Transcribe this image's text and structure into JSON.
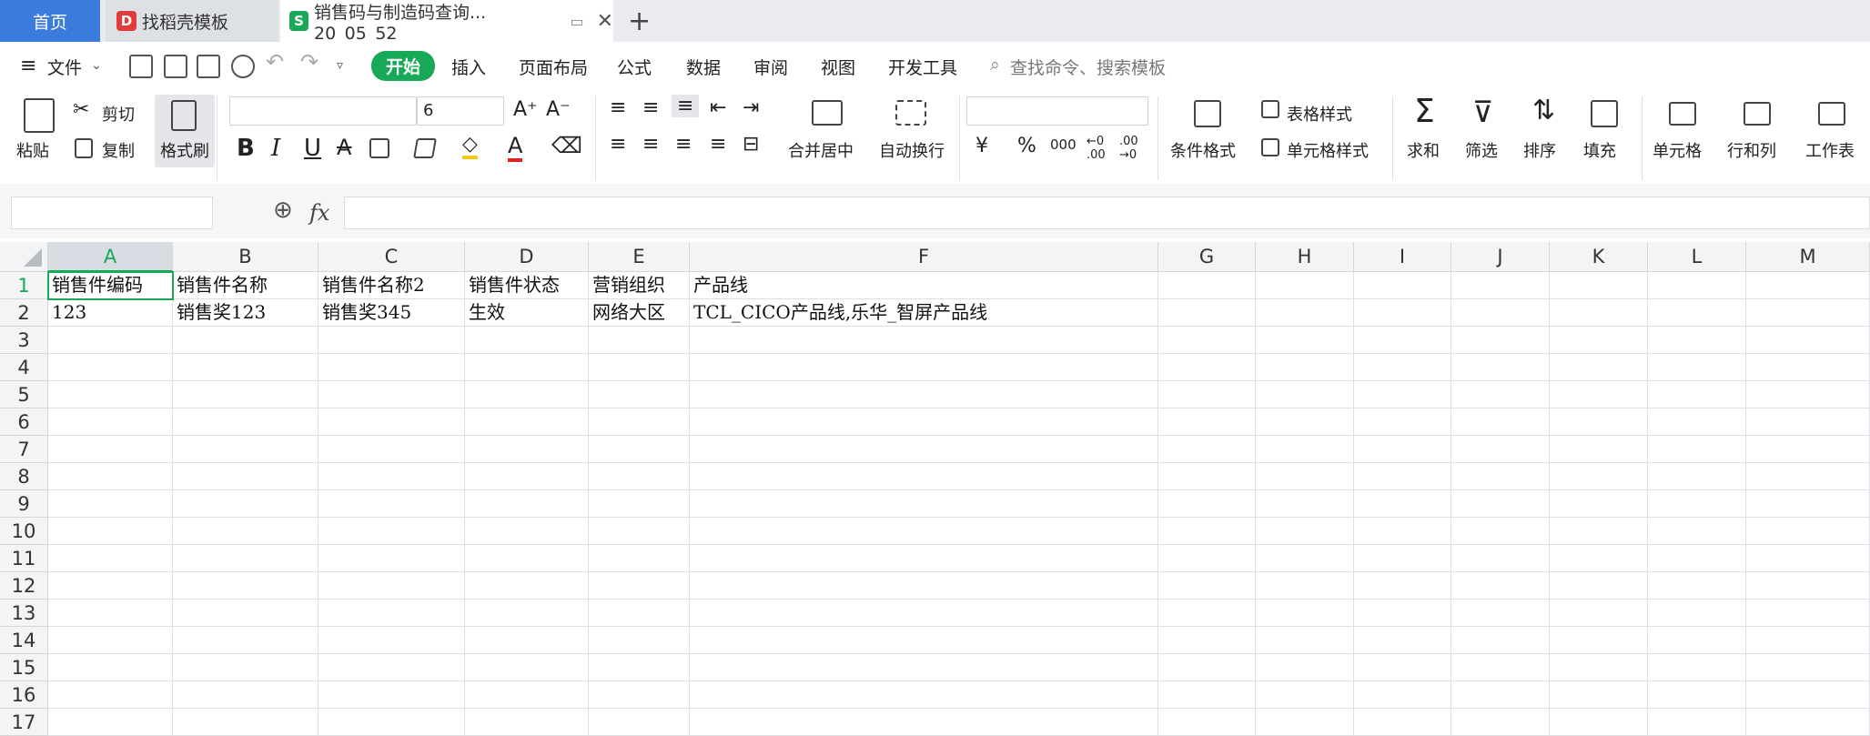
{
  "tabs": {
    "home": "首页",
    "template": "找稻壳模板",
    "doc": "销售码与制造码查询... 20_05_52"
  },
  "menu": {
    "file": "文件",
    "items": [
      "开始",
      "插入",
      "页面布局",
      "公式",
      "数据",
      "审阅",
      "视图",
      "开发工具"
    ],
    "search_placeholder": "查找命令、搜索模板"
  },
  "ribbon": {
    "paste": "粘贴",
    "cut": "剪切",
    "copy": "复制",
    "format_painter": "格式刷",
    "font_size": "6",
    "merge_center": "合并居中",
    "wrap": "自动换行",
    "currency": "¥",
    "percent": "%",
    "thousands": "000",
    "inc_dec": "←0 .00",
    "dec_dec": ".00 →0",
    "cond_format": "条件格式",
    "table_style": "表格样式",
    "cell_style": "单元格样式",
    "sum": "求和",
    "filter": "筛选",
    "sort": "排序",
    "fill": "填充",
    "cells": "单元格",
    "rowcol": "行和列",
    "sheet": "工作表"
  },
  "formula": {
    "fx": "fx"
  },
  "sheet": {
    "columns": [
      "A",
      "B",
      "C",
      "D",
      "E",
      "F",
      "G",
      "H",
      "I",
      "J",
      "K",
      "L",
      "M"
    ],
    "rows": [
      "1",
      "2",
      "3",
      "4",
      "5",
      "6",
      "7",
      "8",
      "9",
      "10",
      "11",
      "12",
      "13",
      "14",
      "15",
      "16",
      "17"
    ],
    "data": [
      [
        "销售件编码",
        "销售件名称",
        "销售件名称2",
        "销售件状态",
        "营销组织",
        "产品线"
      ],
      [
        "123",
        "销售奖123",
        "销售奖345",
        "生效",
        "网络大区",
        "TCL_CICO产品线,乐华_智屏产品线"
      ]
    ],
    "active_cell": "A1"
  },
  "colors": {
    "accent": "#17a858",
    "tab_home": "#3b7bdc"
  }
}
